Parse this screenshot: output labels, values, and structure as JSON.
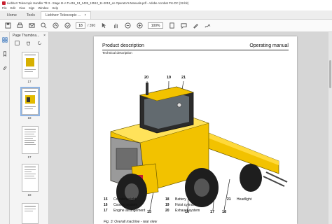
{
  "window": {
    "title": "Liebherr Telescopic Handler Tlt 3 - Stage III-A TL451_13_1435_13512_11-2013_en Operator's Manuals.pdf - Adobe Acrobat Pro DC (32-bit)"
  },
  "menu": [
    "File",
    "Edit",
    "View",
    "Sign",
    "Window",
    "Help"
  ],
  "tabs": [
    {
      "label": "Home"
    },
    {
      "label": "Tools"
    },
    {
      "label": "Liebherr Telescopic ...",
      "close": "×"
    }
  ],
  "toolbar": {
    "current_page": "18",
    "total_pages": "/ 390",
    "zoom": "100%"
  },
  "thumb_panel": {
    "title": "Page Thumbna...",
    "close": "×",
    "pages": [
      "17",
      "18",
      "17",
      "18"
    ]
  },
  "page": {
    "header_left": "Product description",
    "header_right": "Operating manual",
    "subheader": "Technical description",
    "callouts": {
      "c20": "20",
      "c19": "19",
      "c21": "21",
      "c15": "15",
      "c16": "16",
      "c17": "17",
      "c18": "18"
    },
    "caption": "Fig. 3: Overall machine - rear view"
  },
  "legend": [
    {
      "num": "15",
      "label": "Counterweight"
    },
    {
      "num": "16",
      "label": "Cooling system"
    },
    {
      "num": "17",
      "label": "Engine arrangement"
    },
    {
      "num": "18",
      "label": "Battery"
    },
    {
      "num": "19",
      "label": "Hoist cylinder"
    },
    {
      "num": "20",
      "label": "Exhaust system"
    },
    {
      "num": "21",
      "label": "Headlight"
    }
  ],
  "colors": {
    "machine_yellow": "#f2c200",
    "machine_dark": "#2b2b2b",
    "selection": "#8fb4e3"
  }
}
